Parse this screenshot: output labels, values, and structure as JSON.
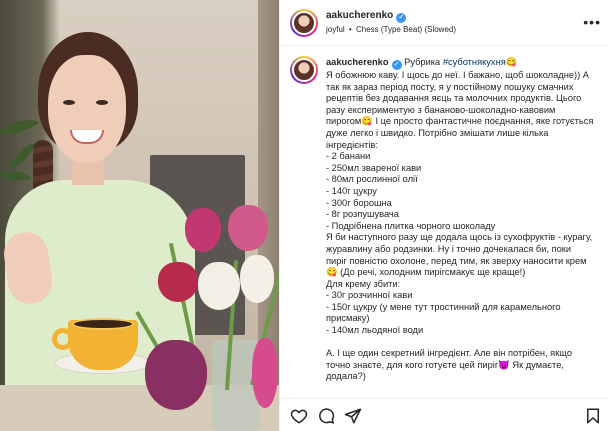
{
  "post": {
    "username": "aakucherenko",
    "audio": {
      "artist": "joyful",
      "separator": "•",
      "track": "Chess (Type Beat) (Slowed)"
    }
  },
  "caption": {
    "username": "aakucherenko",
    "prefix": "Рубрика",
    "hashtag": "#суботнякухня",
    "emoji_after_tag": "😋",
    "lines": [
      "Я обожнюю каву. І щось до неї. І бажано, щоб шоколадне)) А",
      "так як зараз період посту, я у постійному пошуку смачних",
      "рецептів без додавання яєць та молочних продуктів. Цього",
      "разу експериментую з бананово-шоколадно-кавовим",
      "пирогом😋 І це просто фантастичне поєднання, яке готується",
      "дуже легко і швидко. Потрібно змішати лише кілька",
      "інгредієнтів:",
      "- 2 банани",
      "- 250мл звареної кави",
      "- 80мл рослинної олії",
      "- 140г цукру",
      "- 300г борошна",
      "- 8г розпушувача",
      "- Подрібнена плитка чорного шоколаду",
      "Я би наступного разу ще додала щось із сухофруктів - курагу,",
      "журавлину або родзинки. Ну і точно дочекалася би, поки",
      "пиріг повністю охолоне, перед тим, як зверху наносити крем",
      "😋 (До речі, холодним пирігсмакує ще краще!)",
      "Для крему збити:",
      "- 30г розчинної кави",
      "- 150г цукру (у мене тут тростинний для карамельного",
      "присмаку)",
      "- 140мл льодяної води",
      "",
      "А. І ще один секретний інгредієнт. Але він потрібен, якщо",
      "точно знаєте, для кого готуєте цей пиріг😈 Як думаєте,",
      "додала?)"
    ]
  },
  "icons": {
    "verified": "verified-badge-icon",
    "more": "more-options-icon",
    "like": "heart-icon",
    "comment": "comment-icon",
    "share": "share-icon",
    "save": "bookmark-icon"
  },
  "colors": {
    "verified": "#3897f0",
    "hashtag": "#00376b",
    "text": "#262626"
  }
}
